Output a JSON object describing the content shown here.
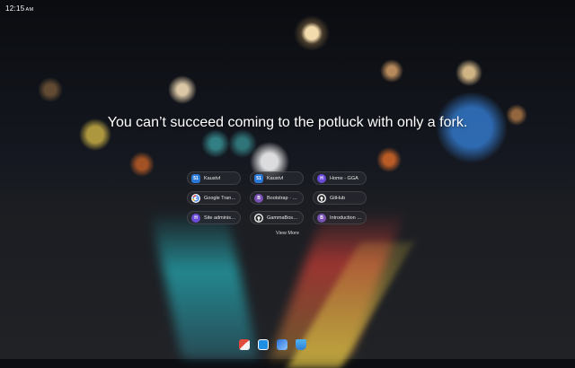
{
  "clock": {
    "time": "12:15",
    "ampm": "AM"
  },
  "quote": "You can’t succeed coming to the potluck with only a fork.",
  "shortcuts": [
    {
      "icon": "51",
      "label": "Kaustvf"
    },
    {
      "icon": "51",
      "label": "Kaustvf"
    },
    {
      "icon": "H",
      "label": "Home - GGA"
    },
    {
      "icon": "G",
      "label": "Google Translate"
    },
    {
      "icon": "B",
      "label": "Bootstrap · The ..."
    },
    {
      "icon": "",
      "label": "GitHub"
    },
    {
      "icon": "H",
      "label": "Site administrat..."
    },
    {
      "icon": "",
      "label": "GammaBoss/N..."
    },
    {
      "icon": "B",
      "label": "Introduction · B..."
    }
  ],
  "view_more": "View More",
  "colors": {
    "tile_bg": "#282a30",
    "text": "#ffffff"
  }
}
